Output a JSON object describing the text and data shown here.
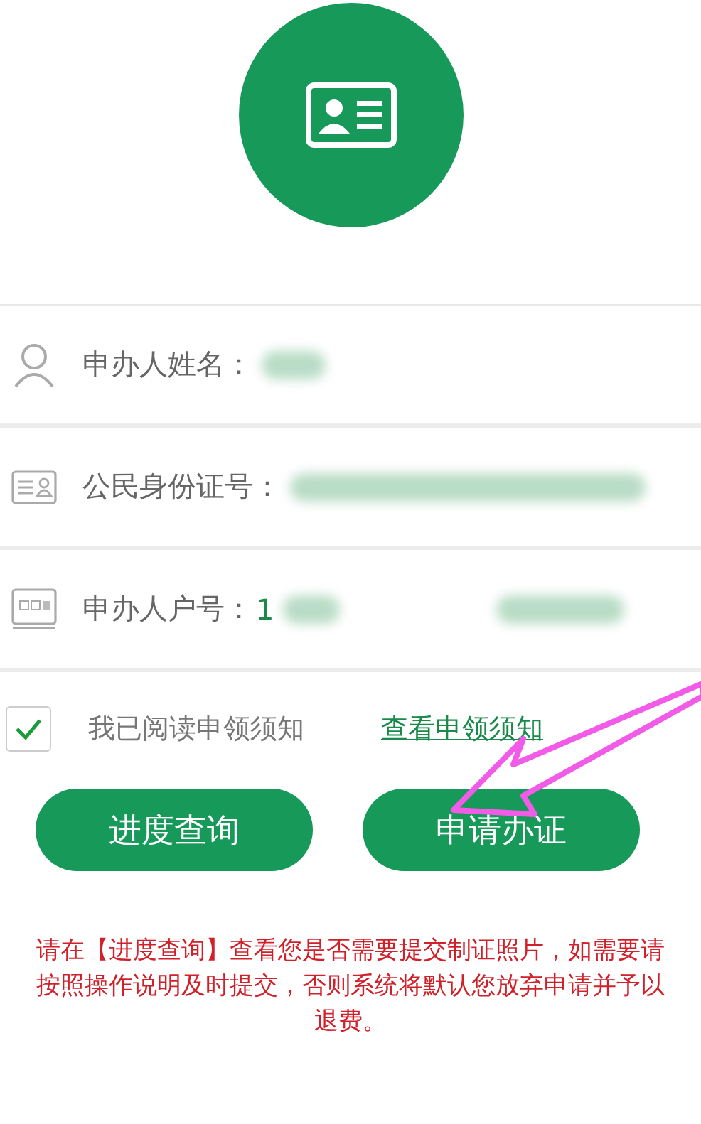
{
  "fields": [
    {
      "kind": "person",
      "label": "申办人姓名："
    },
    {
      "kind": "idcard",
      "label": "公民身份证号："
    },
    {
      "kind": "household",
      "label": "申办人户号：",
      "value": "1"
    }
  ],
  "agreement": {
    "checked": true,
    "label": "我已阅读申领须知",
    "link": "查看申领须知"
  },
  "buttons": [
    "进度查询",
    "申请办证"
  ],
  "notice": "请在【进度查询】查看您是否需要提交制证照片，如需要请按照操作说明及时提交，否则系统将默认您放弃申请并予以退费。"
}
